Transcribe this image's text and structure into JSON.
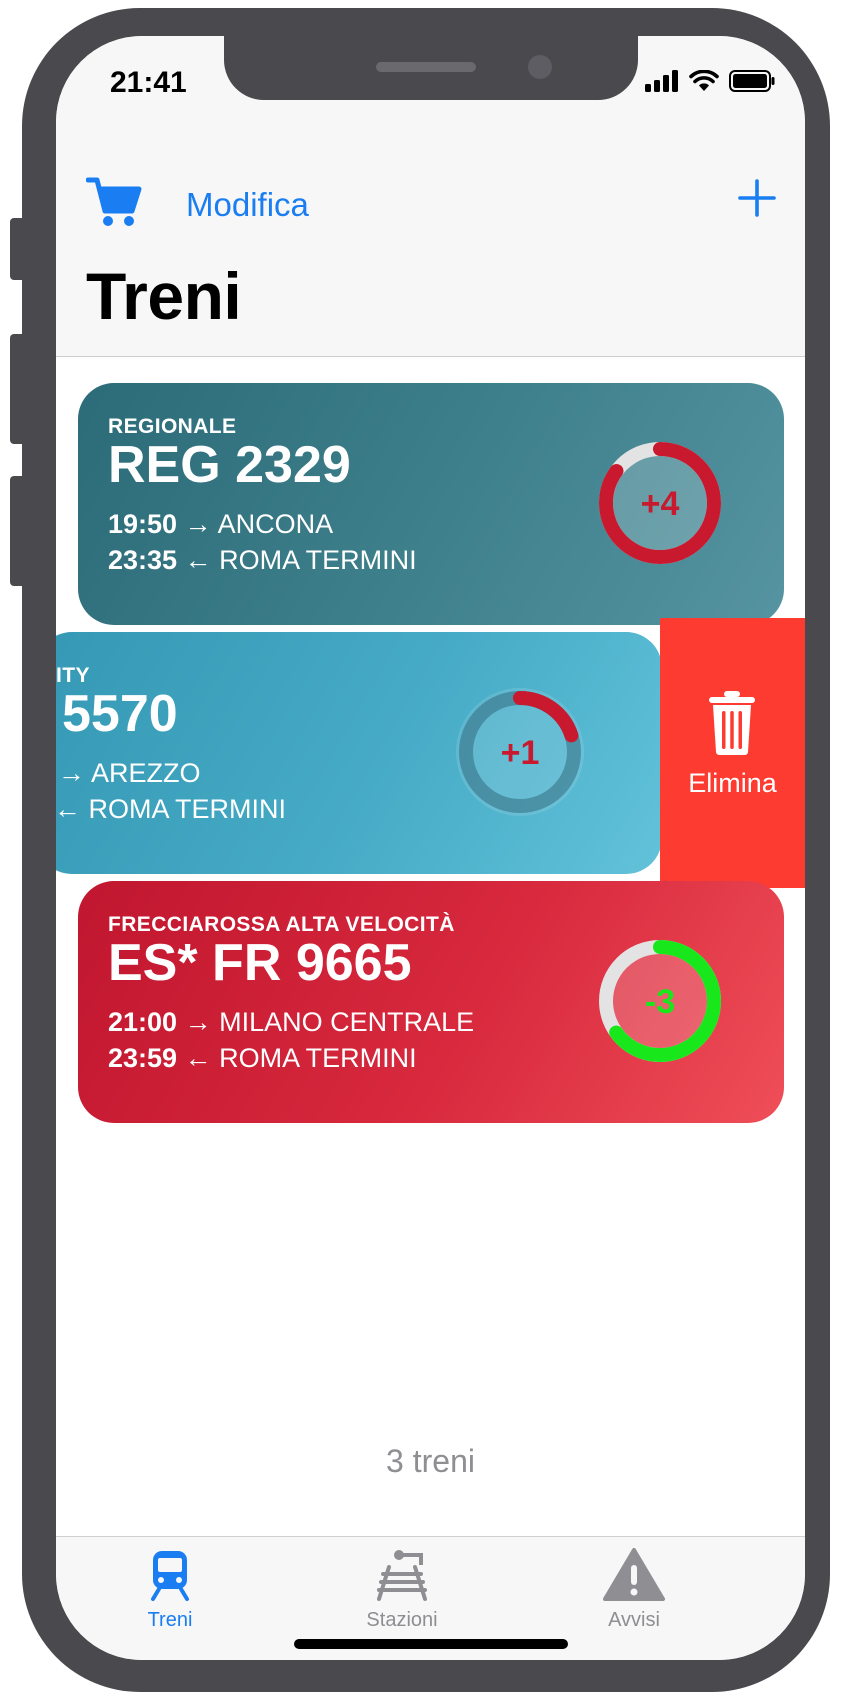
{
  "status_bar": {
    "time": "21:41"
  },
  "nav": {
    "edit_label": "Modifica",
    "title": "Treni"
  },
  "trains": [
    {
      "category": "REGIONALE",
      "number": "REG 2329",
      "departure_time": "19:50",
      "departure_arrow": "→",
      "destination": "ANCONA",
      "arrival_time": "23:35",
      "arrival_arrow": "←",
      "origin": "ROMA TERMINI",
      "delay": "+4",
      "delay_color": "#c8192e",
      "delay_fraction": 0.85
    },
    {
      "category": "ITY",
      "number": "5570",
      "departure_time": "",
      "departure_arrow": "→",
      "destination": "AREZZO",
      "arrival_time": "",
      "arrival_arrow": "←",
      "origin": "ROMA TERMINI",
      "delay": "+1",
      "delay_color": "#c8192e",
      "delay_fraction": 0.2
    },
    {
      "category": "FRECCIAROSSA ALTA VELOCITÀ",
      "number": "ES* FR 9665",
      "departure_time": "21:00",
      "departure_arrow": "→",
      "destination": "MILANO CENTRALE",
      "arrival_time": "23:59",
      "arrival_arrow": "←",
      "origin": "ROMA TERMINI",
      "delay": "-3",
      "delay_color": "#18e81b",
      "delay_fraction": 0.65
    }
  ],
  "swipe_action": {
    "label": "Elimina",
    "color": "#fe3b30"
  },
  "footer": {
    "count_label": "3 treni"
  },
  "tabs": [
    {
      "label": "Treni",
      "icon": "train-icon",
      "active": true
    },
    {
      "label": "Stazioni",
      "icon": "station-icon",
      "active": false
    },
    {
      "label": "Avvisi",
      "icon": "warning-icon",
      "active": false
    }
  ],
  "colors": {
    "accent": "#1a7ef2",
    "inactive": "#8e8e93"
  }
}
